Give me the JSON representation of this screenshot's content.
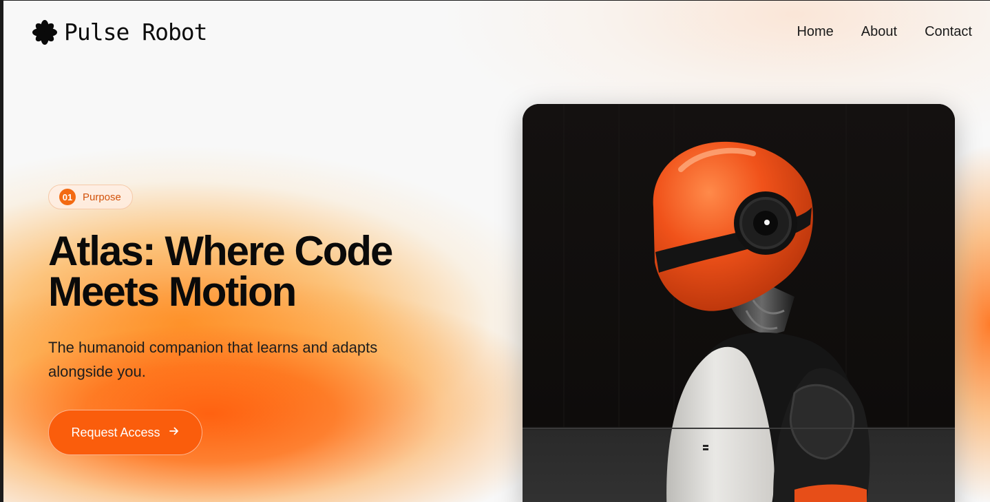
{
  "brand": {
    "name": "Pulse Robot",
    "logo_icon": "asterisk-flower-icon"
  },
  "nav": {
    "items": [
      "Home",
      "About",
      "Contact"
    ]
  },
  "hero": {
    "badge": {
      "number": "01",
      "label": "Purpose"
    },
    "headline_line1": "Atlas: Where Code",
    "headline_line2": "Meets Motion",
    "subtitle_line1": "The humanoid companion that learns and adapts",
    "subtitle_line2": "alongside you.",
    "cta": {
      "label": "Request Access",
      "icon": "arrow-right-icon"
    },
    "image": {
      "subject": "robot-illustration",
      "accent": "#f0521a"
    }
  },
  "colors": {
    "accent": "#fa5d0c",
    "text": "#0a0a0a",
    "badge_border": "#f5c9a8"
  }
}
